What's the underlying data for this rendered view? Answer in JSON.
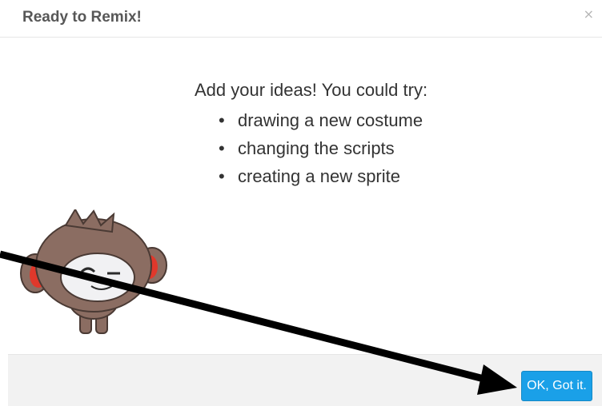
{
  "dialog": {
    "title": "Ready to Remix!",
    "close_glyph": "×",
    "intro": "Add your ideas! You could try:",
    "tips": [
      "drawing a new costume",
      "changing the scripts",
      "creating a new sprite"
    ],
    "ok_label": "OK, Got it."
  },
  "colors": {
    "ok_button": "#1aa0e8",
    "footer_bg": "#f2f2f2",
    "title_text": "#575757",
    "character_fur": "#8b6d62",
    "character_ears": "#e0382b",
    "annotation_arrow": "#000000"
  },
  "icons": {
    "close": "close-icon",
    "bullet": "bullet-icon",
    "mascot": "gobo-mascot"
  }
}
